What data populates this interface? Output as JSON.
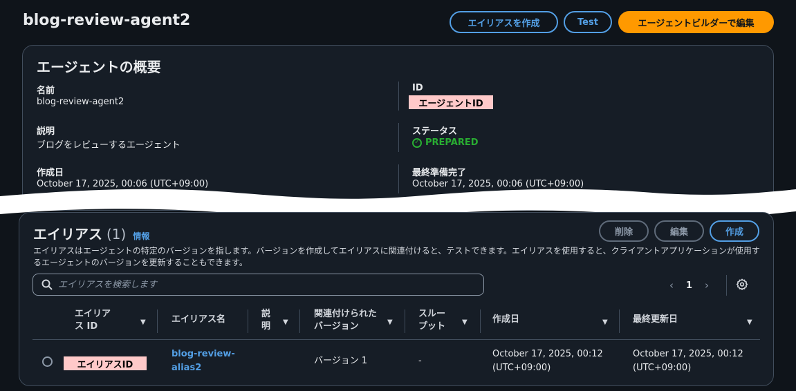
{
  "header": {
    "title": "blog-review-agent2",
    "buttons": {
      "create_alias": "エイリアスを作成",
      "test": "Test",
      "edit_in_builder": "エージェントビルダーで編集"
    }
  },
  "overview": {
    "title": "エージェントの概要",
    "name_label": "名前",
    "name_value": "blog-review-agent2",
    "desc_label": "説明",
    "desc_value": "ブログをレビューするエージェント",
    "created_label": "作成日",
    "created_value": "October 17, 2025, 00:06 (UTC+09:00)",
    "id_label": "ID",
    "id_value": "エージェントID",
    "status_label": "ステータス",
    "status_value": "PREPARED",
    "prepared_label": "最終準備完了",
    "prepared_value": "October 17, 2025, 00:06 (UTC+09:00)"
  },
  "aliases": {
    "title": "エイリアス",
    "count": "(1)",
    "info": "情報",
    "description": "エイリアスはエージェントの特定のバージョンを指します。バージョンを作成してエイリアスに関連付けると、テストできます。エイリアスを使用すると、クライアントアプリケーションが使用するエージェントのバージョンを更新することもできます。",
    "buttons": {
      "delete": "削除",
      "edit": "編集",
      "create": "作成"
    },
    "search_placeholder": "エイリアスを検索します",
    "page": "1",
    "columns": {
      "alias_id": "エイリアス ID",
      "alias_name": "エイリアス名",
      "description": "説明",
      "version": "関連付けられたバージョン",
      "throughput": "スループット",
      "created": "作成日",
      "updated": "最終更新日"
    },
    "rows": [
      {
        "alias_id": "エイリアスID",
        "alias_name_1": "blog-review-",
        "alias_name_2": "alias2",
        "version": "バージョン 1",
        "throughput": "-",
        "created_1": "October 17, 2025, 00:12",
        "created_2": "(UTC+09:00)",
        "updated_1": "October 17, 2025, 00:12",
        "updated_2": "(UTC+09:00)"
      }
    ]
  },
  "colors": {
    "accent": "#539fe5",
    "primary": "#ff9900",
    "success": "#29ad32",
    "redaction": "#ffc9c9"
  }
}
